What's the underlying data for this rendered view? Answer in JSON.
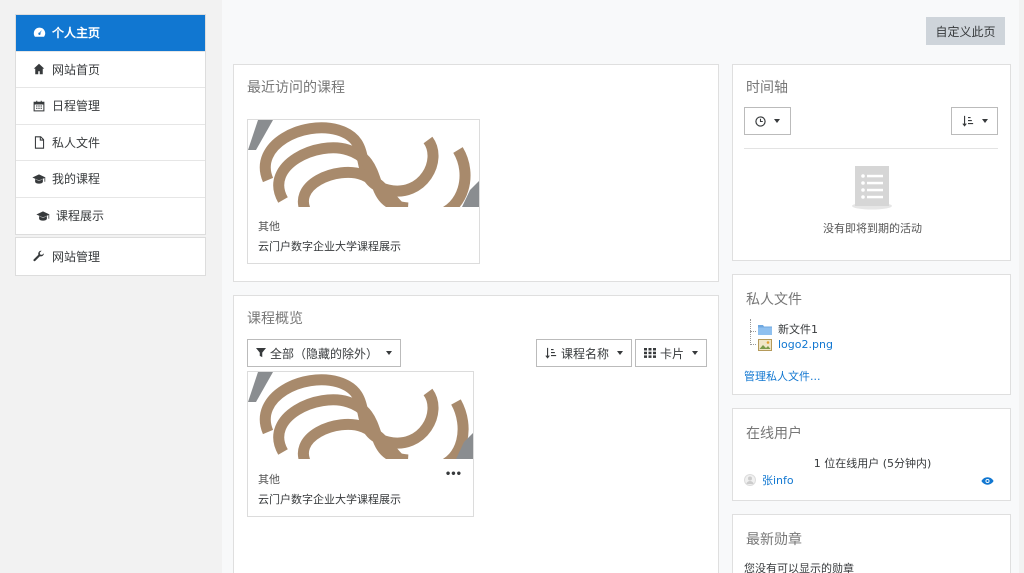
{
  "sidebar": {
    "items": [
      {
        "label": "个人主页",
        "icon": "dashboard-icon"
      },
      {
        "label": "网站首页",
        "icon": "home-icon"
      },
      {
        "label": "日程管理",
        "icon": "calendar-icon"
      },
      {
        "label": "私人文件",
        "icon": "file-icon"
      },
      {
        "label": "我的课程",
        "icon": "graduation-cap-icon"
      },
      {
        "label": "课程展示",
        "icon": "graduation-cap-icon"
      }
    ],
    "admin": {
      "label": "网站管理",
      "icon": "wrench-icon"
    }
  },
  "header": {
    "customize_label": "自定义此页"
  },
  "recent": {
    "title": "最近访问的课程",
    "course": {
      "category": "其他",
      "name": "云门户数字企业大学课程展示"
    }
  },
  "overview": {
    "title": "课程概览",
    "filter_label": "全部（隐藏的除外）",
    "sort_label": "课程名称",
    "view_label": "卡片",
    "course": {
      "category": "其他",
      "name": "云门户数字企业大学课程展示",
      "menu": "•••"
    }
  },
  "timeline": {
    "title": "时间轴",
    "empty_text": "没有即将到期的活动"
  },
  "files": {
    "title": "私人文件",
    "items": [
      {
        "name": "新文件1",
        "type": "folder"
      },
      {
        "name": "logo2.png",
        "type": "image"
      }
    ],
    "manage_link": "管理私人文件..."
  },
  "online": {
    "title": "在线用户",
    "summary": "1 位在线用户 (5分钟内)",
    "user": "张info"
  },
  "badges": {
    "title": "最新勋章",
    "empty_text": "您没有可以显示的勋章"
  },
  "colors": {
    "accent": "#1177d1",
    "logo_brown": "#a88a6c",
    "logo_grey": "#8a8d90"
  }
}
